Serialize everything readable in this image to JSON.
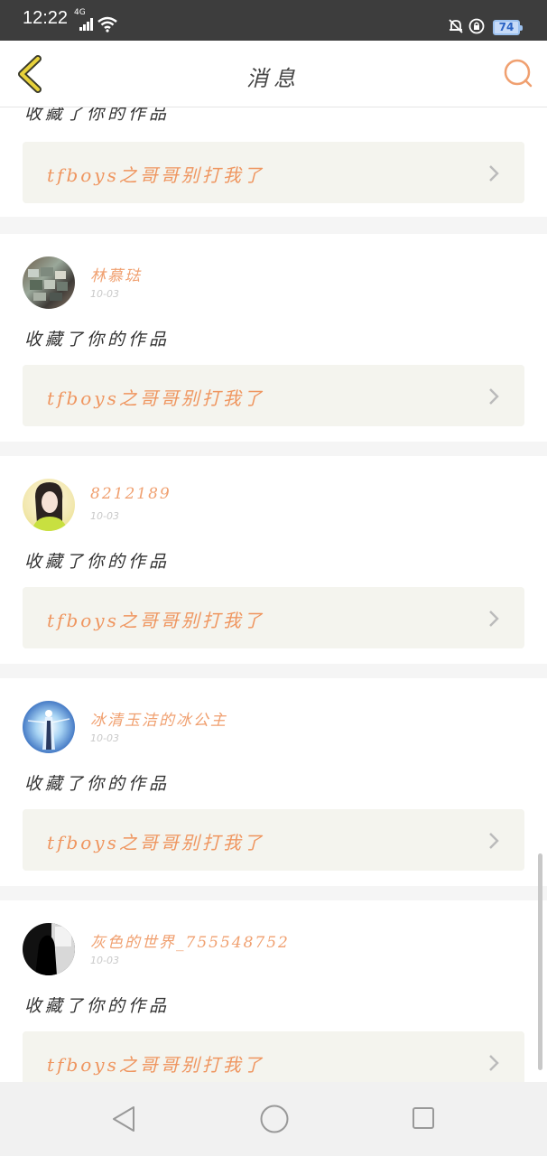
{
  "status_bar": {
    "time": "12:22",
    "network": "4G",
    "battery": "74"
  },
  "header": {
    "title": "消息"
  },
  "top_partial": {
    "action": "收藏了你的作品",
    "work_title": "tfboys之哥哥别打我了"
  },
  "messages": [
    {
      "user": "林慕琺",
      "date": "10-03",
      "action": "收藏了你的作品",
      "work_title": "tfboys之哥哥别打我了"
    },
    {
      "user": "8212189",
      "date": "10-03",
      "action": "收藏了你的作品",
      "work_title": "tfboys之哥哥别打我了"
    },
    {
      "user": "冰清玉洁的冰公主",
      "date": "10-03",
      "action": "收藏了你的作品",
      "work_title": "tfboys之哥哥别打我了"
    },
    {
      "user": "灰色的世界_755548752",
      "date": "10-03",
      "action": "收藏了你的作品",
      "work_title": "tfboys之哥哥别打我了"
    }
  ],
  "colors": {
    "accent": "#ef9660",
    "back_arrow": "#e8d23a",
    "status_bar": "#3d3d3d"
  },
  "icons": {
    "back": "chevron-left-icon",
    "search": "search-icon",
    "row": "chevron-right-icon"
  }
}
